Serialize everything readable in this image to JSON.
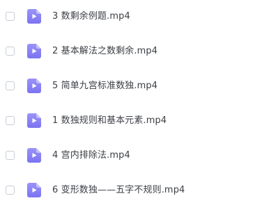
{
  "file_list": {
    "icon": "video-file-icon",
    "accent_color": "#8b84f6",
    "items": [
      {
        "name": "3 数剩余例题.mp4",
        "checked": false
      },
      {
        "name": "2 基本解法之数剩余.mp4",
        "checked": false
      },
      {
        "name": "5 简单九宫标准数独.mp4",
        "checked": false
      },
      {
        "name": "1 数独规则和基本元素.mp4",
        "checked": false
      },
      {
        "name": "4 宫内排除法.mp4",
        "checked": false
      },
      {
        "name": "6 变形数独——五字不规则.mp4",
        "checked": false
      }
    ]
  }
}
